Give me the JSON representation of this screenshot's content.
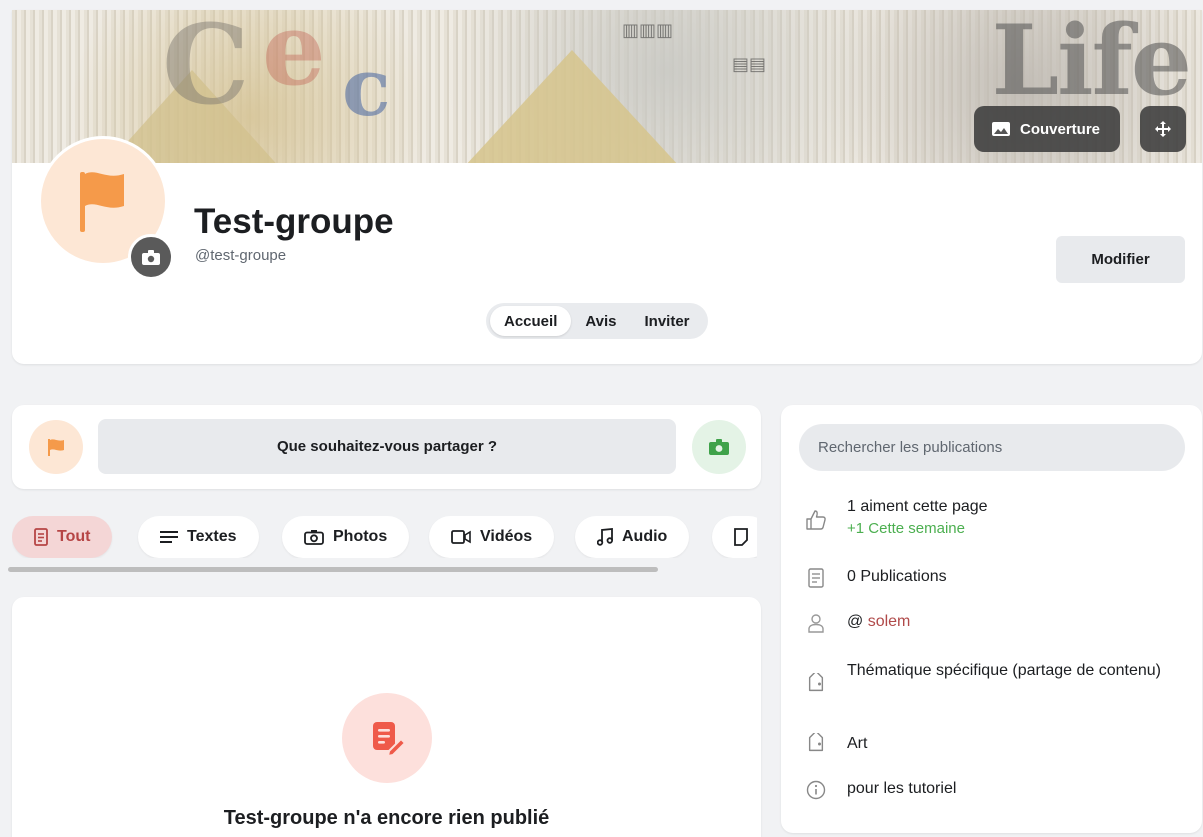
{
  "header": {
    "title": "Test-groupe",
    "handle": "@test-groupe",
    "cover_button_label": "Couverture",
    "edit_button_label": "Modifier",
    "tabs": [
      {
        "label": "Accueil",
        "active": true
      },
      {
        "label": "Avis",
        "active": false
      },
      {
        "label": "Inviter",
        "active": false
      }
    ]
  },
  "composer": {
    "placeholder": "Que souhaitez-vous partager ?"
  },
  "filters": [
    {
      "label": "Tout",
      "icon": "document-icon",
      "active": true
    },
    {
      "label": "Textes",
      "icon": "text-lines-icon",
      "active": false
    },
    {
      "label": "Photos",
      "icon": "camera-icon",
      "active": false
    },
    {
      "label": "Vidéos",
      "icon": "video-icon",
      "active": false
    },
    {
      "label": "Audio",
      "icon": "music-note-icon",
      "active": false
    },
    {
      "label": "",
      "icon": "file-icon",
      "active": false
    }
  ],
  "feed": {
    "empty_message": "Test-groupe n'a encore rien publié"
  },
  "sidebar": {
    "search_placeholder": "Rechercher les publications",
    "likes": "1 aiment cette page",
    "likes_week": "+1 Cette semaine",
    "publications": "0 Publications",
    "owner_prefix": "@",
    "owner_name": "solem",
    "category": "Thématique spécifique (partage de contenu)",
    "tag": "Art",
    "description": "pour les tutoriel"
  },
  "colors": {
    "accent_orange": "#f59a4a",
    "accent_red": "#b64545",
    "accent_green": "#4caf50"
  }
}
